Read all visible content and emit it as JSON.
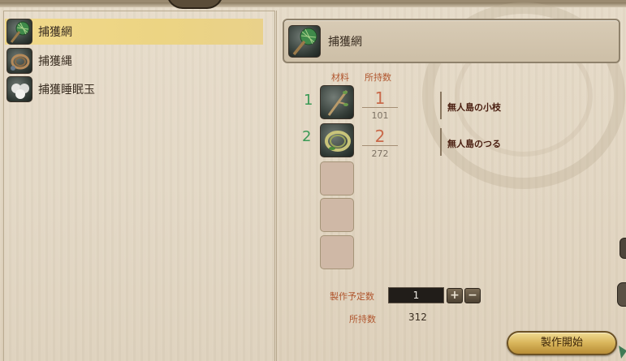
{
  "recipe_list": {
    "items": [
      {
        "label": "捕獲網",
        "icon": "capture-net-icon",
        "selected": true
      },
      {
        "label": "捕獲縄",
        "icon": "capture-rope-icon",
        "selected": false
      },
      {
        "label": "捕獲睡眠玉",
        "icon": "sleep-ball-icon",
        "selected": false
      }
    ]
  },
  "detail": {
    "title": "捕獲網",
    "icon": "capture-net-icon",
    "columns": {
      "materials": "材料",
      "owned": "所持数"
    },
    "materials": [
      {
        "index": "1",
        "required": "1",
        "owned": "101",
        "name": "無人島の小枝",
        "icon": "twig-icon"
      },
      {
        "index": "2",
        "required": "2",
        "owned": "272",
        "name": "無人島のつる",
        "icon": "vine-icon"
      }
    ],
    "empty_slots": 3
  },
  "crafting": {
    "planned_label": "製作予定数",
    "planned_value": "1",
    "plus": "+",
    "minus": "−",
    "owned_label": "所持数",
    "owned_value": "312",
    "start_button": "製作開始"
  },
  "colors": {
    "selected_bg": "#ecd483",
    "number_green": "#3a9a55",
    "required_orange": "#c9694a",
    "label_orange": "#b0562e",
    "material_name": "#4a1e10"
  }
}
